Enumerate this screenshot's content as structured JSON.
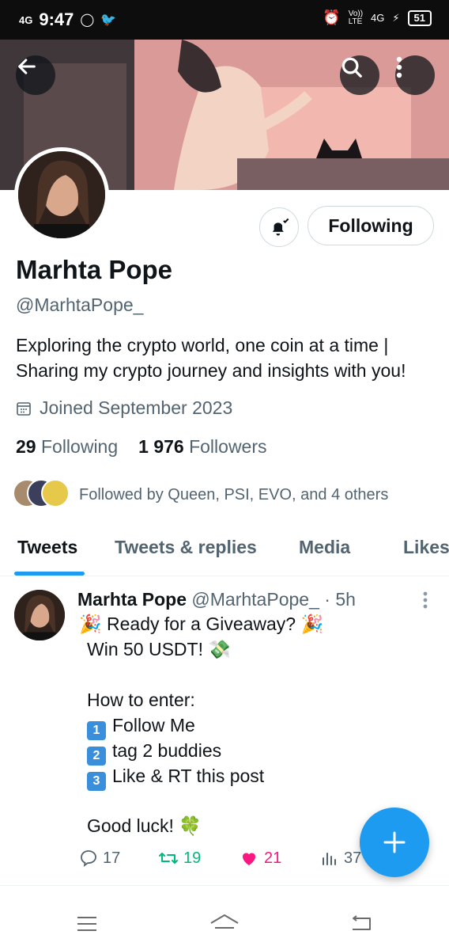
{
  "status_bar": {
    "signal": "4G",
    "time": "9:47",
    "volte": "Vo))",
    "lte": "LTE",
    "network": "4G",
    "battery": "51"
  },
  "profile": {
    "name": "Marhta Pope",
    "handle": "@MarhtaPope_",
    "bio_line1": "Exploring the crypto world, one coin at a time |",
    "bio_line2": "Sharing my crypto journey and insights with you!",
    "joined": "Joined September 2023",
    "following_count": "29",
    "following_label": "Following",
    "followers_count": "1 976",
    "followers_label": "Followers",
    "followed_by": "Followed by Queen, PSI, EVO, and 4 others",
    "follow_button": "Following"
  },
  "tabs": [
    {
      "label": "Tweets",
      "active": true
    },
    {
      "label": "Tweets & replies",
      "active": false
    },
    {
      "label": "Media",
      "active": false
    },
    {
      "label": "Likes",
      "active": false
    }
  ],
  "tweet": {
    "author": "Marhta Pope",
    "handle": "@MarhtaPope_",
    "time": "· 5h",
    "line1": "🎉 Ready for a Giveaway? 🎉",
    "line2": "Win 50 USDT! 💸",
    "line3": "How to enter:",
    "item1": "Follow Me",
    "item2": "tag 2 buddies",
    "item3": "Like & RT this post",
    "item_markers": [
      "1",
      "2",
      "3"
    ],
    "line4": "Good luck! 🍀",
    "replies": "17",
    "retweets": "19",
    "likes": "21",
    "views": "37"
  },
  "colors": {
    "accent": "#1d9bf0",
    "muted": "#536471",
    "retweet": "#00ba7c",
    "like": "#f91880"
  }
}
